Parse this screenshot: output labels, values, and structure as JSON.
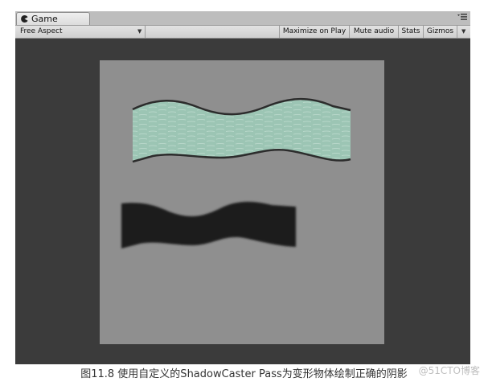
{
  "window": {
    "tab_label": "Game",
    "tab_icon": "pacman-icon",
    "menu_icon": "panel-menu-icon"
  },
  "toolbar": {
    "aspect": "Free Aspect",
    "maximize": "Maximize on Play",
    "mute": "Mute audio",
    "stats": "Stats",
    "gizmos": "Gizmos"
  },
  "scene": {
    "background_color": "#8f8f8f",
    "wave_plane_color": "#9cc5b4",
    "wave_outline_color": "#2c2c2c",
    "shadow_color": "#1c1c1c"
  },
  "caption": "图11.8 使用自定义的ShadowCaster Pass为变形物体绘制正确的阴影",
  "watermark": "@51CTO博客"
}
